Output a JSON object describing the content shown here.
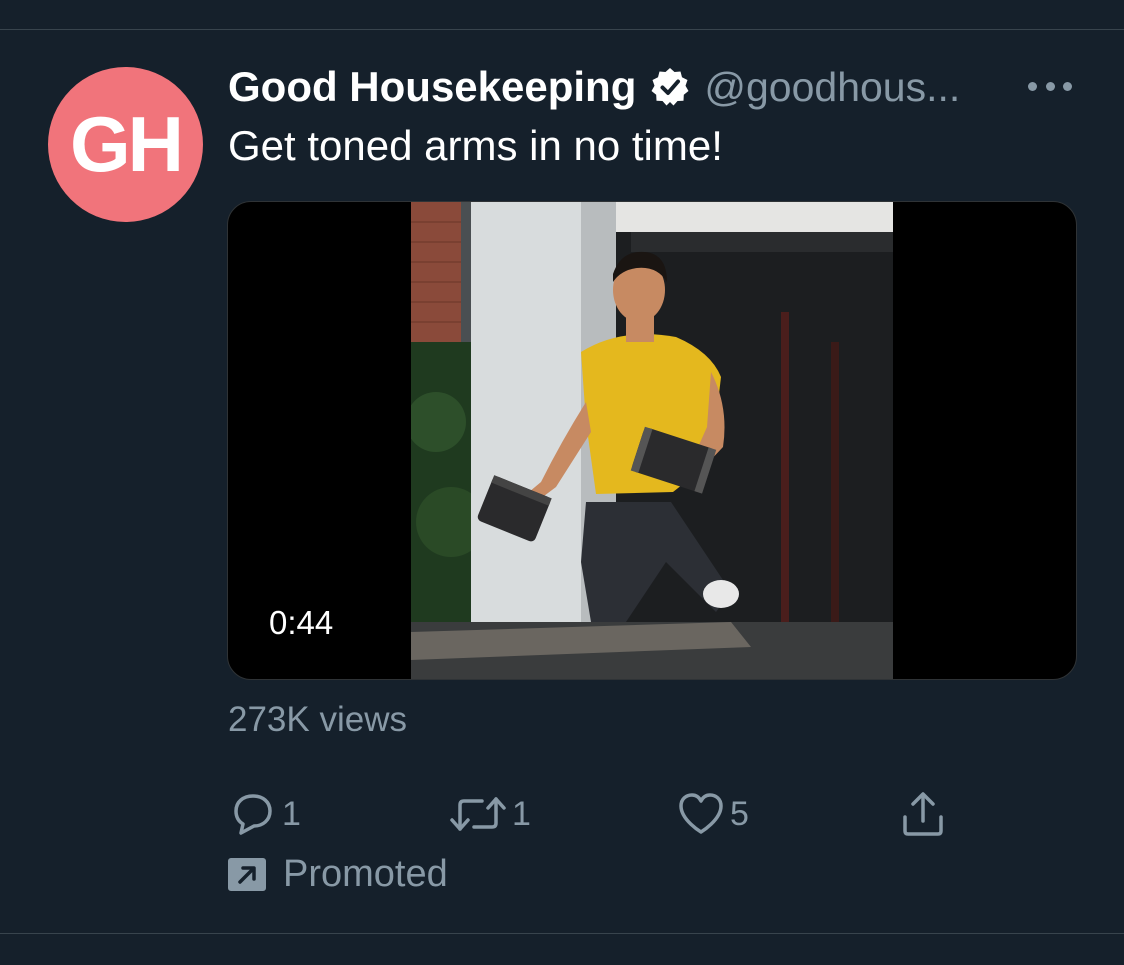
{
  "tweet": {
    "avatar_text": "GH",
    "display_name": "Good Housekeeping",
    "handle": "@goodhous...",
    "text": "Get toned arms in no time!",
    "video_duration": "0:44",
    "views": "273K views",
    "promoted_label": "Promoted"
  },
  "actions": {
    "reply_count": "1",
    "retweet_count": "1",
    "like_count": "5"
  },
  "icons": {
    "verified": "verified-badge-icon",
    "more": "more-dots-icon",
    "reply": "reply-icon",
    "retweet": "retweet-icon",
    "like": "heart-icon",
    "share": "share-icon",
    "promoted": "promoted-arrow-icon"
  },
  "colors": {
    "background": "#15202b",
    "secondary_text": "#8899a6",
    "avatar": "#f1747b",
    "divider": "#38444d"
  }
}
